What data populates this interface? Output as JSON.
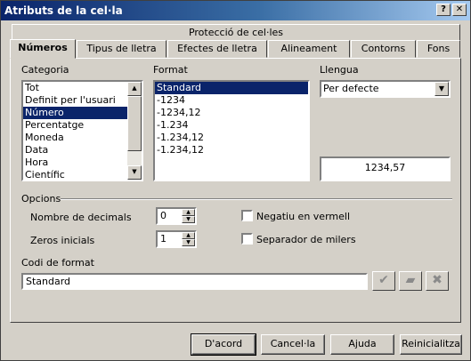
{
  "window": {
    "title": "Atributs de la cel·la",
    "close_glyph": "✕",
    "help_glyph": "?"
  },
  "tabs_top": [
    {
      "label": "Protecció de cel·les"
    }
  ],
  "tabs": [
    {
      "label": "Números",
      "active": true
    },
    {
      "label": "Tipus de lletra"
    },
    {
      "label": "Efectes de lletra"
    },
    {
      "label": "Alineament"
    },
    {
      "label": "Contorns"
    },
    {
      "label": "Fons"
    }
  ],
  "category": {
    "label": "Categoria",
    "items": [
      "Tot",
      "Definit per l'usuari",
      "Número",
      "Percentatge",
      "Moneda",
      "Data",
      "Hora",
      "Científic"
    ],
    "selected": "Número"
  },
  "format": {
    "label": "Format",
    "items": [
      "Standard",
      "-1234",
      "-1234,12",
      "-1.234",
      "-1.234,12",
      "-1.234,12"
    ],
    "selected": "Standard"
  },
  "language": {
    "label": "Llengua",
    "value": "Per defecte"
  },
  "preview": {
    "value": "1234,57"
  },
  "options": {
    "title": "Opcions",
    "decimals_label": "Nombre de decimals",
    "decimals_value": "0",
    "leading_zeros_label": "Zeros inicials",
    "leading_zeros_value": "1",
    "negative_red_label": "Negatiu en vermell",
    "thousands_sep_label": "Separador de milers"
  },
  "format_code": {
    "label": "Codi de format",
    "value": "Standard"
  },
  "buttons": {
    "ok": "D'acord",
    "cancel": "Cancel·la",
    "help": "Ajuda",
    "reset": "Reinicialitza"
  },
  "icons": {
    "accept": "check-icon",
    "comment": "comment-icon",
    "delete": "delete-icon"
  }
}
